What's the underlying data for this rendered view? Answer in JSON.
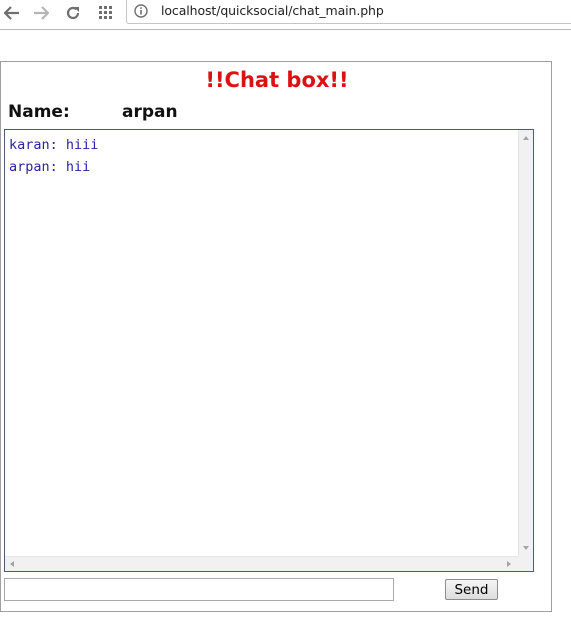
{
  "browser": {
    "url": "localhost/quicksocial/chat_main.php",
    "icons": [
      "back-arrow-icon",
      "forward-arrow-icon",
      "reload-icon",
      "apps-grid-icon",
      "page-info-icon"
    ]
  },
  "chat": {
    "title": "!!Chat box!!",
    "title_color": "#dd1111",
    "name_label": "Name:",
    "name_value": "arpan",
    "messages": [
      {
        "text": "karan: hiii"
      },
      {
        "text": "arpan: hii"
      }
    ],
    "message_color": "#2b22a8",
    "input_value": "",
    "send_label": "Send"
  }
}
